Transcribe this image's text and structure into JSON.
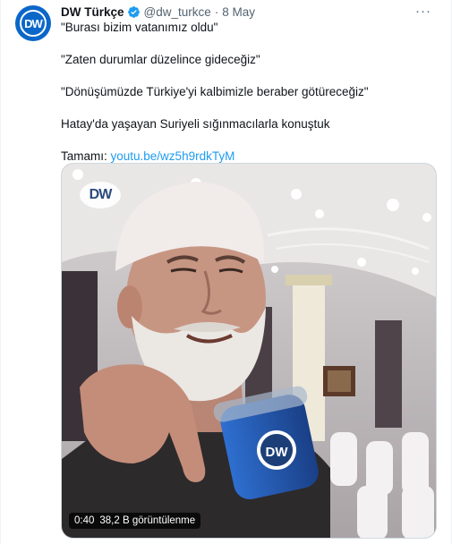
{
  "tweet": {
    "author_name": "DW Türkçe",
    "handle": "@dw_turkce",
    "separator": "·",
    "date": "8 May",
    "more_label": "···",
    "avatar_text": "DW",
    "lines": [
      "\"Burası bizim vatanımız oldu\"",
      "\"Zaten durumlar düzelince gideceğiz\"",
      "\"Dönüşümüzde Türkiye'yi kalbimizle beraber götüreceğiz\"",
      "Hatay'da yaşayan Suriyeli sığınmacılarla konuştuk"
    ],
    "link_prefix": "Tamamı: ",
    "link_text": "youtu.be/wz5h9rdkTyM"
  },
  "video": {
    "watermark": "DW",
    "mic_logo": "DW",
    "duration": "0:40",
    "views": "38,2 B görüntülenme"
  },
  "colors": {
    "link": "#1d9bf0",
    "verified": "#1d9bf0",
    "brand": "#0a67c9"
  }
}
